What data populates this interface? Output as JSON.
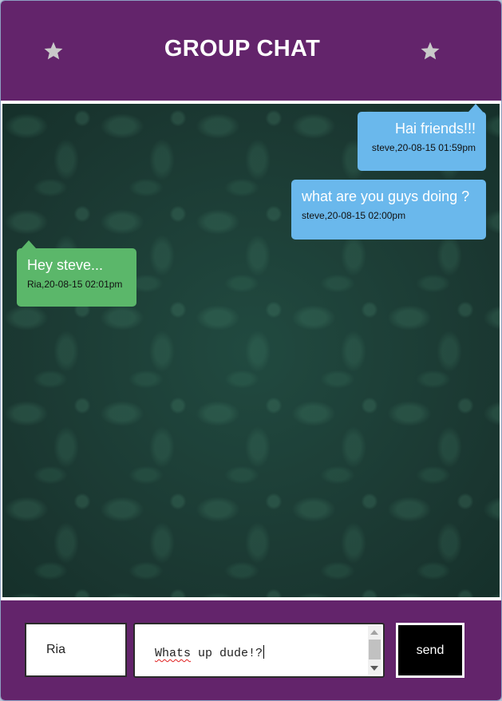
{
  "header": {
    "title": "GROUP CHAT",
    "left_icon": "star-icon",
    "right_icon": "star-icon"
  },
  "messages": [
    {
      "text": "Hai friends!!!",
      "meta": "steve,20-08-15 01:59pm",
      "side": "sent"
    },
    {
      "text": "what are you guys doing ?",
      "meta": "steve,20-08-15 02:00pm",
      "side": "sent"
    },
    {
      "text": "Hey steve...",
      "meta": "Ria,20-08-15 02:01pm",
      "side": "received"
    }
  ],
  "composer": {
    "name_value": "Ria",
    "message_value_word1": "Whats",
    "message_value_rest": " up dude!?",
    "send_label": "send"
  },
  "colors": {
    "header_bg": "#63246b",
    "sent_bubble": "#6ab8ec",
    "received_bubble": "#5bb76a",
    "send_button_bg": "#000000",
    "star_icon": "#c9c9c9"
  }
}
